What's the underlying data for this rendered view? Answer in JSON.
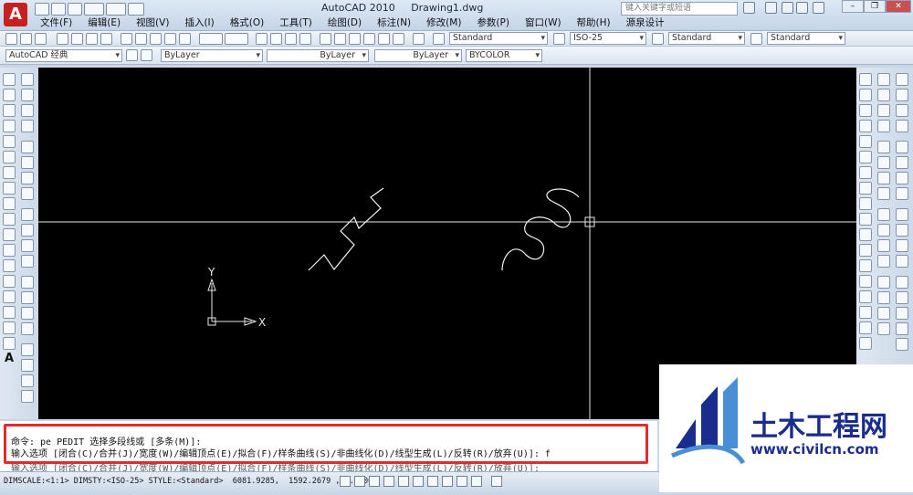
{
  "window": {
    "title": "AutoCAD 2010     Drawing1.dwg",
    "search_placeholder": "键入关键字或短语"
  },
  "menu": [
    "文件(F)",
    "编辑(E)",
    "视图(V)",
    "插入(I)",
    "格式(O)",
    "工具(T)",
    "绘图(D)",
    "标注(N)",
    "修改(M)",
    "参数(P)",
    "窗口(W)",
    "帮助(H)",
    "源泉设计"
  ],
  "toolbar1": {
    "text_style": "Standard",
    "dim_style": "ISO-25",
    "table_style": "Standard",
    "multileader_style": "Standard"
  },
  "toolbar2": {
    "workspace": "AutoCAD 经典",
    "layer": "ByLayer",
    "color": "ByLayer",
    "linetype": "ByLayer",
    "lineweight": "BYCOLOR"
  },
  "ucs": {
    "x_label": "X",
    "y_label": "Y"
  },
  "command": {
    "line1": "命令: pe PEDIT 选择多段线或 [多条(M)]:",
    "line2": "输入选项 [闭合(C)/合并(J)/宽度(W)/编辑顶点(E)/拟合(F)/样条曲线(S)/非曲线化(D)/线型生成(L)/反转(R)/放弃(U)]: f",
    "line3": "输入选项 [闭合(C)/合并(J)/宽度(W)/编辑顶点(E)/拟合(F)/样条曲线(S)/非曲线化(D)/线型生成(L)/反转(R)/放弃(U)]:"
  },
  "status": {
    "text": "DIMSCALE:<1:1> DIMSTY:<ISO-25> STYLE:<Standard>  6081.9285,  1592.2679 , 0.0000"
  },
  "watermark": {
    "brand": "土木工程网",
    "url": "www.civilcn.com"
  },
  "colors": {
    "watermark_blue": "#1a2d8c",
    "highlight_red": "#e22b2b",
    "canvas": "#000000"
  }
}
